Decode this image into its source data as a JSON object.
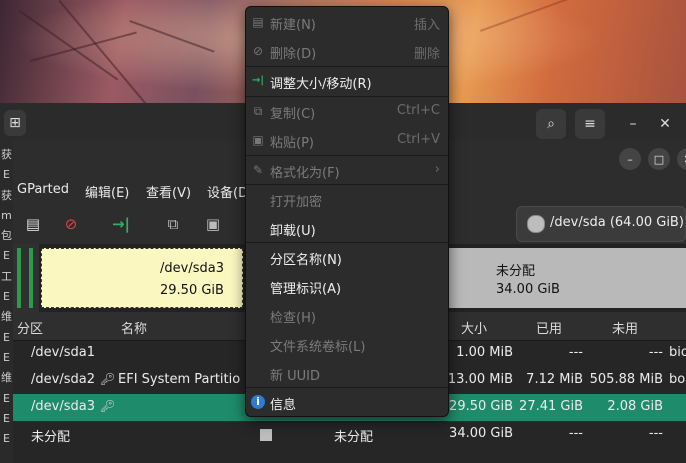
{
  "outer_window": {
    "left_strip_chars": [
      "获",
      "E",
      "获",
      "m",
      "包",
      "E",
      "工",
      "E",
      "维",
      "E",
      "E",
      "维",
      "E",
      "E",
      "E"
    ]
  },
  "gparted": {
    "menubar": [
      "GParted",
      "编辑(E)",
      "查看(V)",
      "设备(D"
    ],
    "device_selector": "/dev/sda (64.00 GiB)",
    "disk_map": {
      "sda3_name": "/dev/sda3",
      "sda3_size": "29.50 GiB",
      "unalloc_name": "未分配",
      "unalloc_size": "34.00 GiB"
    },
    "table": {
      "headers": [
        "分区",
        "名称",
        "大小",
        "已用",
        "未用"
      ],
      "rows": [
        {
          "partition": "/dev/sda1",
          "name": "",
          "filesystem": "",
          "size": "1.00 MiB",
          "used": "---",
          "unused": "---",
          "flags": "bio"
        },
        {
          "partition": "/dev/sda2",
          "name": "EFI System Partitio",
          "filesystem": "",
          "size": "13.00 MiB",
          "used": "7.12 MiB",
          "unused": "505.88 MiB",
          "flags": "bo"
        },
        {
          "partition": "/dev/sda3",
          "name": "",
          "filesystem": "",
          "size": "29.50 GiB",
          "used": "27.41 GiB",
          "unused": "2.08 GiB",
          "flags": ""
        },
        {
          "partition": "未分配",
          "name": "",
          "filesystem": "未分配",
          "size": "34.00 GiB",
          "used": "---",
          "unused": "---",
          "flags": ""
        }
      ]
    }
  },
  "context_menu": {
    "items": [
      {
        "label": "新建(N)",
        "shortcut": "插入",
        "enabled": false,
        "icon": "new-icon"
      },
      {
        "label": "删除(D)",
        "shortcut": "删除",
        "enabled": false,
        "icon": "delete-icon"
      },
      {
        "label": "调整大小/移动(R)",
        "shortcut": "",
        "enabled": true,
        "icon": "resize-icon"
      },
      {
        "label": "复制(C)",
        "shortcut": "Ctrl+C",
        "enabled": false,
        "icon": "copy-icon"
      },
      {
        "label": "粘贴(P)",
        "shortcut": "Ctrl+V",
        "enabled": false,
        "icon": "paste-icon"
      },
      {
        "label": "格式化为(F)",
        "shortcut": "›",
        "enabled": false,
        "icon": "format-icon"
      },
      {
        "label": "打开加密",
        "shortcut": "",
        "enabled": false,
        "icon": ""
      },
      {
        "label": "卸载(U)",
        "shortcut": "",
        "enabled": true,
        "icon": ""
      },
      {
        "label": "分区名称(N)",
        "shortcut": "",
        "enabled": true,
        "icon": ""
      },
      {
        "label": "管理标识(A)",
        "shortcut": "",
        "enabled": true,
        "icon": ""
      },
      {
        "label": "检查(H)",
        "shortcut": "",
        "enabled": false,
        "icon": ""
      },
      {
        "label": "文件系统卷标(L)",
        "shortcut": "",
        "enabled": false,
        "icon": ""
      },
      {
        "label": "新 UUID",
        "shortcut": "",
        "enabled": false,
        "icon": ""
      },
      {
        "label": "信息",
        "shortcut": "",
        "enabled": true,
        "icon": "info-icon"
      }
    ]
  },
  "colors": {
    "selected_row": "#1e8c6a",
    "sda3_fill": "#fbf7c0",
    "unalloc_fill": "#b9b9b9",
    "partition_bar": "#2e9a4e"
  }
}
